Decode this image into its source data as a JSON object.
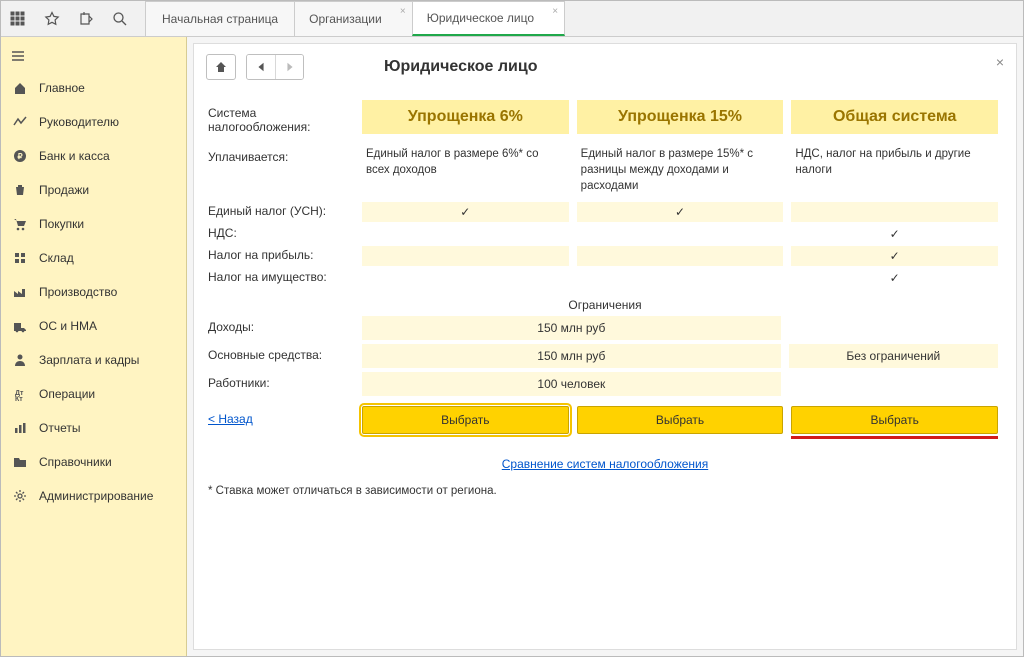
{
  "tabs": {
    "home": "Начальная страница",
    "org": "Организации",
    "legal": "Юридическое лицо"
  },
  "sidebar": {
    "items": [
      {
        "label": "Главное"
      },
      {
        "label": "Руководителю"
      },
      {
        "label": "Банк и касса"
      },
      {
        "label": "Продажи"
      },
      {
        "label": "Покупки"
      },
      {
        "label": "Склад"
      },
      {
        "label": "Производство"
      },
      {
        "label": "ОС и НМА"
      },
      {
        "label": "Зарплата и кадры"
      },
      {
        "label": "Операции"
      },
      {
        "label": "Отчеты"
      },
      {
        "label": "Справочники"
      },
      {
        "label": "Администрирование"
      }
    ]
  },
  "page": {
    "title": "Юридическое лицо",
    "tax_system_label": "Система налогообложения:",
    "paid_label": "Уплачивается:",
    "tax_rows": [
      "Единый налог (УСН):",
      "НДС:",
      "Налог на прибыль:",
      "Налог на имущество:"
    ],
    "limits_title": "Ограничения",
    "limit_rows": [
      "Доходы:",
      "Основные средства:",
      "Работники:"
    ],
    "back_link": "< Назад",
    "compare_link": "Сравнение систем налогообложения",
    "footnote": "* Ставка может отличаться в зависимости от региона."
  },
  "plans": [
    {
      "name": "Упрощенка 6%",
      "desc": "Единый налог в размере 6%* со всех доходов",
      "taxes": [
        true,
        false,
        false,
        false
      ],
      "select": "Выбрать"
    },
    {
      "name": "Упрощенка 15%",
      "desc": "Единый налог в размере 15%* с разницы между доходами и расходами",
      "taxes": [
        true,
        false,
        false,
        false
      ],
      "select": "Выбрать"
    },
    {
      "name": "Общая система",
      "desc": "НДС, налог на прибыль и другие налоги",
      "taxes": [
        false,
        true,
        true,
        true
      ],
      "select": "Выбрать"
    }
  ],
  "limits": {
    "income": "150 млн руб",
    "assets": "150 млн руб",
    "staff": "100 человек",
    "none": "Без ограничений"
  }
}
